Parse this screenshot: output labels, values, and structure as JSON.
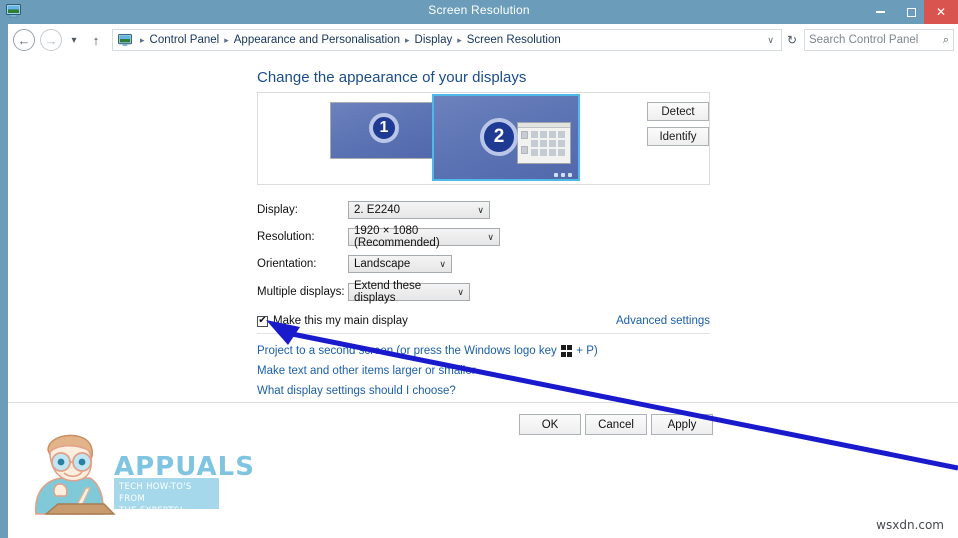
{
  "window": {
    "title": "Screen Resolution",
    "icon": "display-monitor-icon",
    "controls": {
      "minimize_label": "–",
      "maximize_label": "□",
      "close_label": "✕",
      "close_color": "#d9534f"
    },
    "titlebar_color": "#6b9dba"
  },
  "navbar": {
    "back_label": "←",
    "forward_label": "→",
    "history_label": "▾",
    "up_label": "↑",
    "refresh_label": "↻",
    "breadcrumb_dropdown_label": "∨",
    "breadcrumb_separator": "▸",
    "breadcrumb": [
      "Control Panel",
      "Appearance and Personalisation",
      "Display",
      "Screen Resolution"
    ]
  },
  "search": {
    "placeholder": "Search Control Panel",
    "icon": "search-icon",
    "icon_glyph": "⌕",
    "value": ""
  },
  "main": {
    "heading": "Change the appearance of your displays",
    "heading_color": "#1b4c8c",
    "displays": [
      {
        "number": "1",
        "selected": false
      },
      {
        "number": "2",
        "selected": true
      }
    ],
    "selection_color": "#4fb9e8",
    "buttons": {
      "detect": "Detect",
      "identify": "Identify"
    },
    "fields": [
      {
        "label": "Display:",
        "value": "2. E2240",
        "arrow": "∨"
      },
      {
        "label": "Resolution:",
        "value": "1920 × 1080 (Recommended)",
        "arrow": "∨"
      },
      {
        "label": "Orientation:",
        "value": "Landscape",
        "arrow": "∨"
      },
      {
        "label": "Multiple displays:",
        "value": "Extend these displays",
        "arrow": "∨"
      }
    ],
    "main_display_checkbox": {
      "label": "Make this my main display",
      "checked": true,
      "check_glyph": "✔"
    },
    "advanced_settings_link": "Advanced settings",
    "links": {
      "project_before": "Project to a second screen (or press the Windows logo key",
      "project_after": "+ P)",
      "text_size": "Make text and other items larger or smaller",
      "choose": "What display settings should I choose?"
    },
    "link_color": "#1b5fa8"
  },
  "footer": {
    "ok": "OK",
    "cancel": "Cancel",
    "apply": "Apply"
  },
  "watermarks": {
    "logo_word": "APPUALS",
    "logo_tag_line1": "TECH HOW-TO'S FROM",
    "logo_tag_line2": "THE EXPERTS!",
    "logo_accent": "#7fc4e0",
    "site": "wsxdn.com"
  },
  "annotation": {
    "arrow_color": "#1a1acd",
    "target": "main-display-checkbox"
  }
}
